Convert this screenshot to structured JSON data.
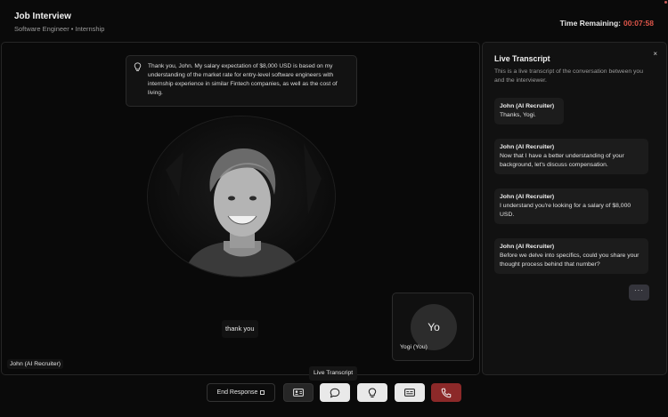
{
  "header": {
    "title": "Job Interview",
    "subtitle": "Software Engineer • Internship",
    "timer_label": "Time Remaining:",
    "timer_value": "00:07:58"
  },
  "stage": {
    "speech_text": "Thank you, John. My salary expectation of $8,000 USD is based on my understanding of the market rate for entry-level software engineers with internship experience in similar Fintech companies, as well as the cost of living.",
    "caption": "thank you",
    "recruiter_label": "John (AI Recruiter)"
  },
  "self_tile": {
    "initials": "Yo",
    "label": "Yogi (You)"
  },
  "transcript": {
    "title": "Live Transcript",
    "close": "×",
    "description": "This is a live transcript of the conversation between you and the interviewer.",
    "messages": [
      {
        "speaker": "John (AI Recruiter)",
        "text": "Thanks, Yogi."
      },
      {
        "speaker": "John (AI Recruiter)",
        "text": "Now that I have a better understanding of your background, let's discuss compensation."
      },
      {
        "speaker": "John (AI Recruiter)",
        "text": "I understand you're looking for a salary of $8,000 USD."
      },
      {
        "speaker": "John (AI Recruiter)",
        "text": "Before we delve into specifics, could you share your thought process behind that number?"
      }
    ],
    "more": "···"
  },
  "controls": {
    "tooltip": "Live Transcript",
    "end_response": "End Response",
    "icons": [
      "id-card-icon",
      "chat-bubble-icon",
      "lightbulb-icon",
      "captions-icon",
      "phone-icon"
    ]
  },
  "colors": {
    "timer_accent": "#e0564a",
    "hangup_button": "#8c2929"
  }
}
